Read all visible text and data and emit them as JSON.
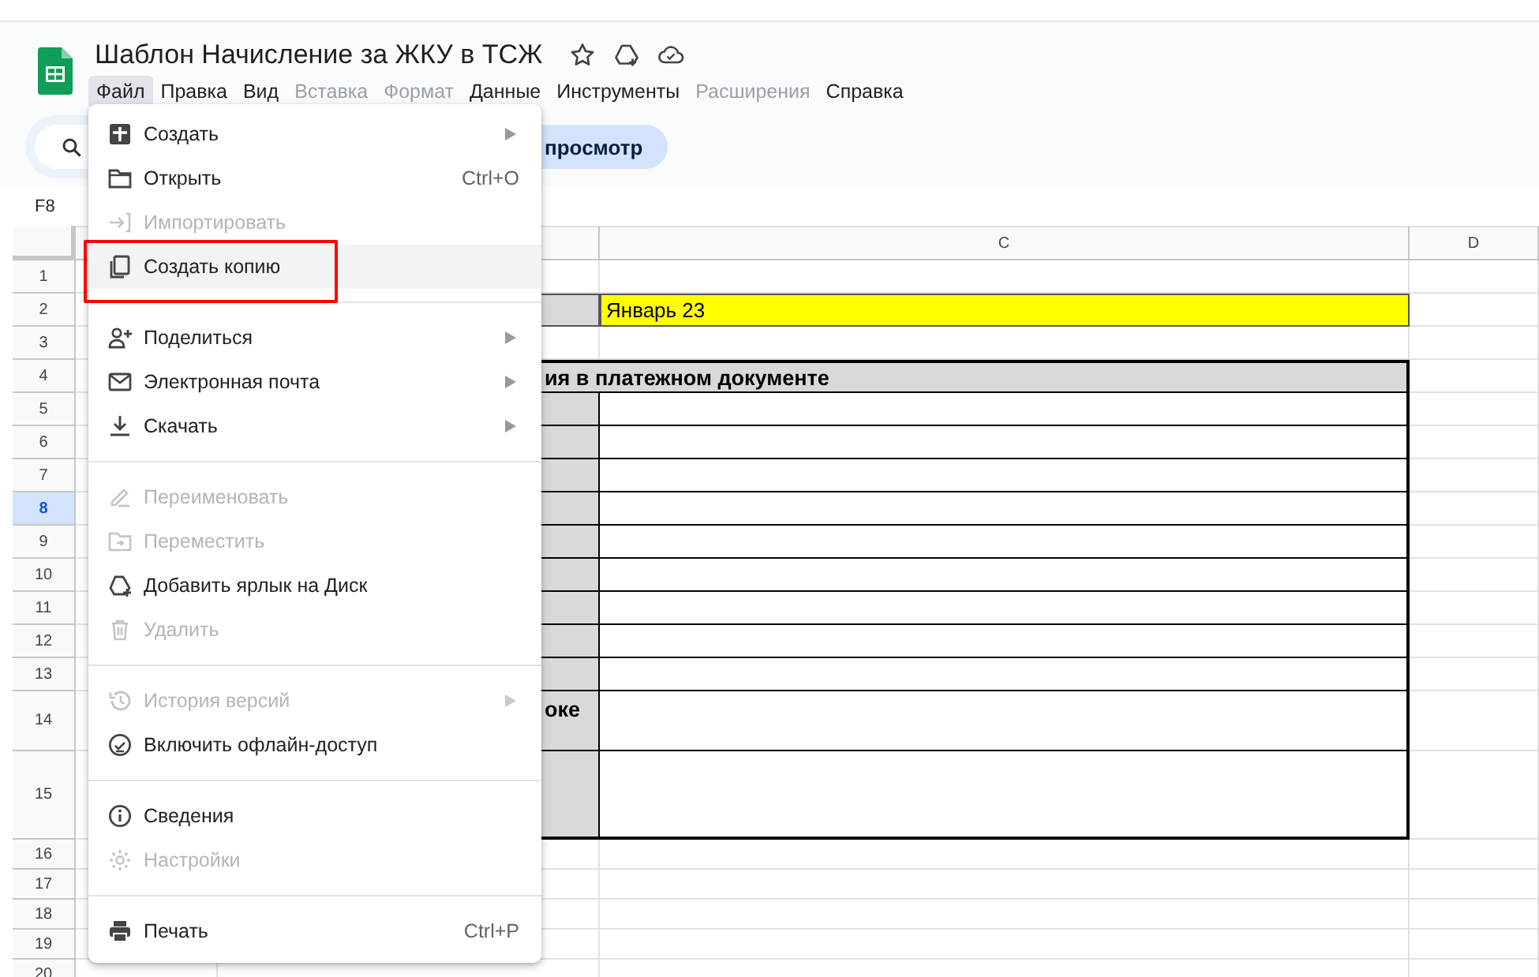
{
  "document": {
    "title": "Шаблон Начисление за ЖКУ в ТСЖ"
  },
  "menubar": [
    {
      "label": "Файл",
      "selected": true,
      "disabled": false
    },
    {
      "label": "Правка",
      "selected": false,
      "disabled": false
    },
    {
      "label": "Вид",
      "selected": false,
      "disabled": false
    },
    {
      "label": "Вставка",
      "selected": false,
      "disabled": true
    },
    {
      "label": "Формат",
      "selected": false,
      "disabled": true
    },
    {
      "label": "Данные",
      "selected": false,
      "disabled": false
    },
    {
      "label": "Инструменты",
      "selected": false,
      "disabled": false
    },
    {
      "label": "Расширения",
      "selected": false,
      "disabled": true
    },
    {
      "label": "Справка",
      "selected": false,
      "disabled": false
    }
  ],
  "toolbar": {
    "chip": "просмотр"
  },
  "name_box": "F8",
  "columns": [
    {
      "label": "C"
    },
    {
      "label": "D"
    }
  ],
  "rows": [
    {
      "number": "1",
      "selected": false
    },
    {
      "number": "2",
      "selected": false,
      "c_text": "Январь 23"
    },
    {
      "number": "3",
      "selected": false
    },
    {
      "number": "4",
      "selected": false,
      "span_text": "ия в платежном документе"
    },
    {
      "number": "5",
      "selected": false
    },
    {
      "number": "6",
      "selected": false
    },
    {
      "number": "7",
      "selected": false
    },
    {
      "number": "8",
      "selected": true
    },
    {
      "number": "9",
      "selected": false
    },
    {
      "number": "10",
      "selected": false
    },
    {
      "number": "11",
      "selected": false
    },
    {
      "number": "12",
      "selected": false
    },
    {
      "number": "13",
      "selected": false
    },
    {
      "number": "14",
      "selected": false,
      "b_text": "оке"
    },
    {
      "number": "15",
      "selected": false
    },
    {
      "number": "16",
      "selected": false
    },
    {
      "number": "17",
      "selected": false
    },
    {
      "number": "18",
      "selected": false
    },
    {
      "number": "19",
      "selected": false
    },
    {
      "number": "20",
      "selected": false
    }
  ],
  "file_menu": {
    "sections": [
      [
        {
          "label": "Создать",
          "submenu": true,
          "disabled": false,
          "hovered": false,
          "highlighted": false
        },
        {
          "label": "Открыть",
          "shortcut": "Ctrl+O",
          "submenu": false,
          "disabled": false,
          "hovered": false,
          "highlighted": false
        },
        {
          "label": "Импортировать",
          "submenu": false,
          "disabled": true,
          "hovered": false,
          "highlighted": false
        },
        {
          "label": "Создать копию",
          "submenu": false,
          "disabled": false,
          "hovered": true,
          "highlighted": true
        }
      ],
      [
        {
          "label": "Поделиться",
          "submenu": true,
          "disabled": false,
          "hovered": false,
          "highlighted": false
        },
        {
          "label": "Электронная почта",
          "submenu": true,
          "disabled": false,
          "hovered": false,
          "highlighted": false
        },
        {
          "label": "Скачать",
          "submenu": true,
          "disabled": false,
          "hovered": false,
          "highlighted": false
        }
      ],
      [
        {
          "label": "Переименовать",
          "submenu": false,
          "disabled": true,
          "hovered": false,
          "highlighted": false
        },
        {
          "label": "Переместить",
          "submenu": false,
          "disabled": true,
          "hovered": false,
          "highlighted": false
        },
        {
          "label": "Добавить ярлык на Диск",
          "submenu": false,
          "disabled": false,
          "hovered": false,
          "highlighted": false
        },
        {
          "label": "Удалить",
          "submenu": false,
          "disabled": true,
          "hovered": false,
          "highlighted": false
        }
      ],
      [
        {
          "label": "История версий",
          "submenu": true,
          "disabled": true,
          "hovered": false,
          "highlighted": false
        },
        {
          "label": "Включить офлайн-доступ",
          "submenu": false,
          "disabled": false,
          "hovered": false,
          "highlighted": false
        }
      ],
      [
        {
          "label": "Сведения",
          "submenu": false,
          "disabled": false,
          "hovered": false,
          "highlighted": false
        },
        {
          "label": "Настройки",
          "submenu": false,
          "disabled": true,
          "hovered": false,
          "highlighted": false
        }
      ],
      [
        {
          "label": "Печать",
          "shortcut": "Ctrl+P",
          "submenu": false,
          "disabled": false,
          "hovered": false,
          "highlighted": false
        }
      ]
    ]
  }
}
